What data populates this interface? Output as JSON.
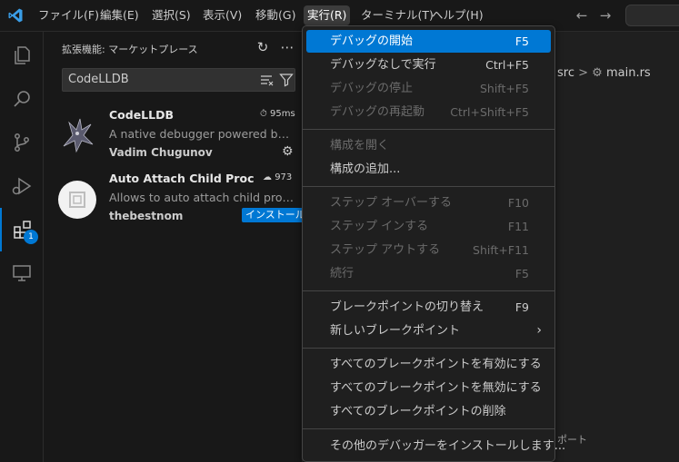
{
  "titlebar": {
    "menus": [
      "ファイル(F)",
      "編集(E)",
      "選択(S)",
      "表示(V)",
      "移動(G)",
      "実行(R)",
      "ターミナル(T)",
      "ヘルプ(H)"
    ],
    "back_icon": "arrow-left-icon",
    "forward_icon": "arrow-right-icon"
  },
  "activitybar": {
    "items": [
      "explorer-icon",
      "search-icon",
      "source-control-icon",
      "run-debug-icon",
      "extensions-icon",
      "remote-explorer-icon"
    ],
    "extensions_badge": "1"
  },
  "sidebar": {
    "title": "拡張機能: マーケットプレース",
    "refresh_icon": "refresh-icon",
    "more_icon": "ellipsis-icon",
    "search_value": "CodeLLDB",
    "extensions": [
      {
        "name": "CodeLLDB",
        "description": "A native debugger powered by LL...",
        "publisher": "Vadim Chugunov",
        "stat": "95ms"
      },
      {
        "name": "Auto Attach Child Proce...",
        "description": "Allows to auto attach child proces...",
        "publisher": "thebestnom",
        "stat": "973",
        "install_label": "インストール"
      }
    ]
  },
  "editor": {
    "breadcrumb_folder": "src",
    "breadcrumb_sep": ">",
    "breadcrumb_file": "main.rs",
    "panel_tab": "ポート"
  },
  "run_menu": {
    "start_debugging": {
      "label": "デバッグの開始",
      "key": "F5"
    },
    "run_without_debugging": {
      "label": "デバッグなしで実行",
      "key": "Ctrl+F5"
    },
    "stop_debugging": {
      "label": "デバッグの停止",
      "key": "Shift+F5"
    },
    "restart_debugging": {
      "label": "デバッグの再起動",
      "key": "Ctrl+Shift+F5"
    },
    "open_configurations": {
      "label": "構成を開く"
    },
    "add_configuration": {
      "label": "構成の追加..."
    },
    "step_over": {
      "label": "ステップ オーバーする",
      "key": "F10"
    },
    "step_into": {
      "label": "ステップ インする",
      "key": "F11"
    },
    "step_out": {
      "label": "ステップ アウトする",
      "key": "Shift+F11"
    },
    "continue": {
      "label": "続行",
      "key": "F5"
    },
    "toggle_breakpoint": {
      "label": "ブレークポイントの切り替え",
      "key": "F9"
    },
    "new_breakpoint": {
      "label": "新しいブレークポイント"
    },
    "enable_all_breakpoints": {
      "label": "すべてのブレークポイントを有効にする"
    },
    "disable_all_breakpoints": {
      "label": "すべてのブレークポイントを無効にする"
    },
    "remove_all_breakpoints": {
      "label": "すべてのブレークポイントの削除"
    },
    "install_additional_debuggers": {
      "label": "その他のデバッガーをインストールします..."
    }
  },
  "colors": {
    "accent": "#0078d4",
    "background": "#1f1f1f",
    "sidebar": "#181818"
  }
}
